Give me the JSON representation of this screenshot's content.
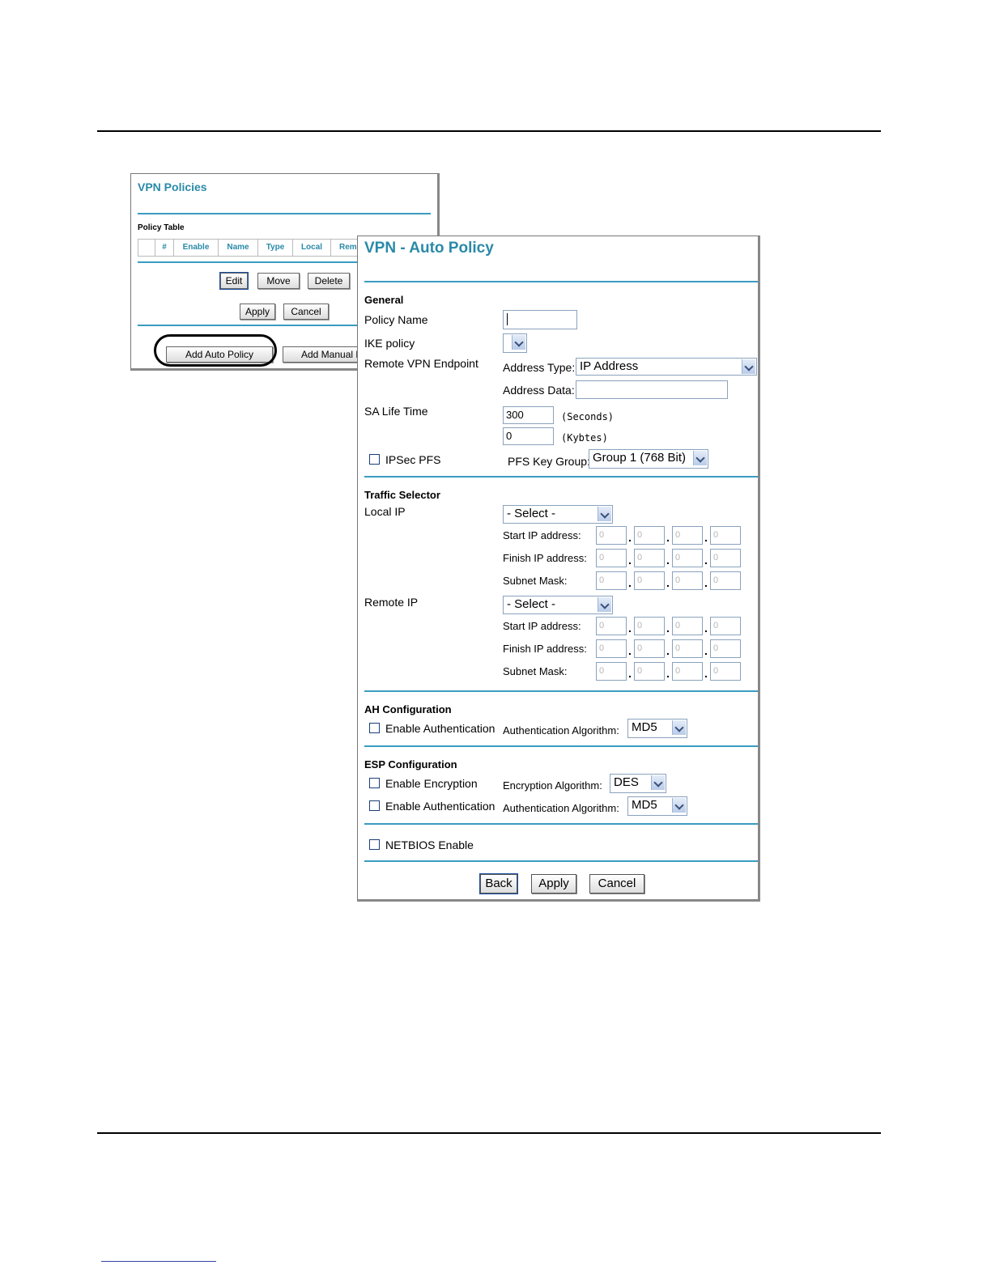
{
  "vpn_policies": {
    "title": "VPN Policies",
    "table_label": "Policy Table",
    "columns": [
      "#",
      "Enable",
      "Name",
      "Type",
      "Local",
      "Remo"
    ],
    "edit": "Edit",
    "move": "Move",
    "delete": "Delete",
    "apply": "Apply",
    "cancel": "Cancel",
    "add_auto": "Add Auto Policy",
    "add_manual": "Add Manual P"
  },
  "auto_policy": {
    "title": "VPN - Auto Policy",
    "general": {
      "heading": "General",
      "policy_name_label": "Policy Name",
      "policy_name_value": "",
      "ike_policy_label": "IKE policy",
      "ike_policy_value": "",
      "remote_endpoint_label": "Remote VPN Endpoint",
      "address_type_label": "Address Type:",
      "address_type_value": "IP Address",
      "address_data_label": "Address Data:",
      "address_data_value": "",
      "sa_life_label": "SA Life Time",
      "seconds_value": "300",
      "seconds_unit": "(Seconds)",
      "kbytes_value": "0",
      "kbytes_unit": "(Kybtes)",
      "ipsec_pfs_label": "IPSec PFS",
      "ipsec_pfs_checked": false,
      "pfs_key_group_label": "PFS Key Group:",
      "pfs_key_group_value": "Group 1 (768 Bit)"
    },
    "traffic": {
      "heading": "Traffic Selector",
      "local_ip_label": "Local IP",
      "local_ip_select": "- Select -",
      "remote_ip_label": "Remote IP",
      "remote_ip_select": "- Select -",
      "start_label": "Start IP address:",
      "finish_label": "Finish IP address:",
      "mask_label": "Subnet Mask:",
      "octet_placeholder": "0"
    },
    "ah": {
      "heading": "AH Configuration",
      "enable_auth_label": "Enable Authentication",
      "enable_auth_checked": false,
      "auth_algo_label": "Authentication Algorithm:",
      "auth_algo_value": "MD5"
    },
    "esp": {
      "heading": "ESP Configuration",
      "enable_enc_label": "Enable Encryption",
      "enable_enc_checked": false,
      "enc_algo_label": "Encryption Algorithm:",
      "enc_algo_value": "DES",
      "enable_auth_label": "Enable Authentication",
      "enable_auth_checked": false,
      "auth_algo_label": "Authentication Algorithm:",
      "auth_algo_value": "MD5"
    },
    "netbios_label": "NETBIOS Enable",
    "netbios_checked": false,
    "back": "Back",
    "apply": "Apply",
    "cancel": "Cancel"
  }
}
